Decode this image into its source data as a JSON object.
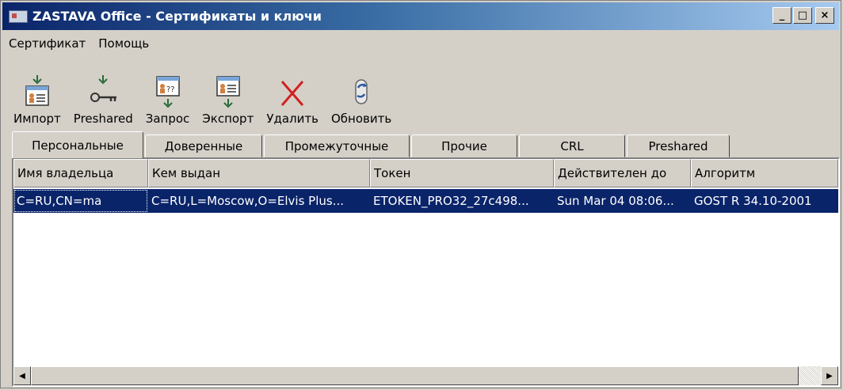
{
  "window": {
    "title": "ZASTAVA Office - Сертификаты и ключи"
  },
  "title_buttons": {
    "minimize": "_",
    "maximize": "□",
    "close": "×"
  },
  "menu": [
    "Сертификат",
    "Помощь"
  ],
  "toolbar": [
    {
      "label": "Импорт",
      "icon": "import-certificate-icon"
    },
    {
      "label": "Preshared",
      "icon": "key-icon"
    },
    {
      "label": "Запрос",
      "icon": "request-certificate-icon"
    },
    {
      "label": "Экспорт",
      "icon": "export-certificate-icon"
    },
    {
      "label": "Удалить",
      "icon": "delete-x-icon"
    },
    {
      "label": "Обновить",
      "icon": "refresh-icon"
    }
  ],
  "tabs": [
    "Персональные",
    "Доверенные",
    "Промежуточные",
    "Прочие",
    "CRL",
    "Preshared"
  ],
  "active_tab": "Персональные",
  "table": {
    "columns": [
      "Имя владельца",
      "Кем выдан",
      "Токен",
      "Действителен до",
      "Алгоритм"
    ],
    "rows": [
      [
        "C=RU,CN=ma",
        "C=RU,L=Moscow,O=Elvis Plus...",
        "ETOKEN_PRO32_27c498...",
        "Sun Mar 04 08:06...",
        "GOST R 34.10-2001"
      ]
    ]
  },
  "colors": {
    "selection": "#0a246a",
    "title_start": "#0a246a",
    "title_end": "#a6caf0",
    "delete_red": "#d22020"
  }
}
